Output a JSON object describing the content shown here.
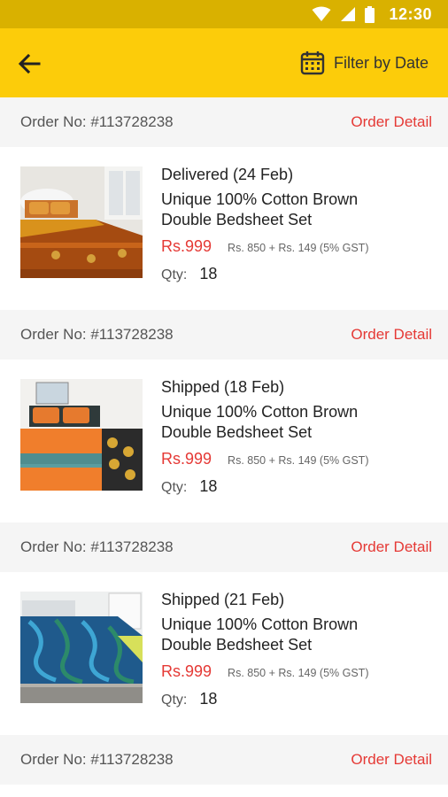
{
  "status_bar": {
    "time": "12:30"
  },
  "app_bar": {
    "filter_label": "Filter by Date"
  },
  "orders": [
    {
      "order_no": "Order No: #113728238",
      "detail_label": "Order Detail",
      "status": "Delivered (24 Feb)",
      "title": "Unique 100% Cotton Brown Double Bedsheet Set",
      "price": "Rs.999",
      "price_breakup": "Rs. 850 + Rs. 149 (5% GST)",
      "qty_label": "Qty:",
      "qty": "18"
    },
    {
      "order_no": "Order No: #113728238",
      "detail_label": "Order Detail",
      "status": "Shipped (18 Feb)",
      "title": "Unique 100% Cotton Brown Double Bedsheet Set",
      "price": "Rs.999",
      "price_breakup": "Rs. 850 + Rs. 149 (5% GST)",
      "qty_label": "Qty:",
      "qty": "18"
    },
    {
      "order_no": "Order No: #113728238",
      "detail_label": "Order Detail",
      "status": "Shipped (21 Feb)",
      "title": "Unique 100% Cotton Brown Double Bedsheet Set",
      "price": "Rs.999",
      "price_breakup": "Rs. 850 + Rs. 149 (5% GST)",
      "qty_label": "Qty:",
      "qty": "18"
    },
    {
      "order_no": "Order No: #113728238",
      "detail_label": "Order Detail"
    }
  ],
  "colors": {
    "app_bar": "#fccc0a",
    "status_bar": "#d9b100",
    "accent_red": "#e53935",
    "header_bg": "#f5f5f5"
  },
  "icons": {
    "back": "arrow-left-icon",
    "filter": "calendar-icon",
    "wifi": "wifi-icon",
    "signal": "signal-icon",
    "battery": "battery-icon"
  }
}
